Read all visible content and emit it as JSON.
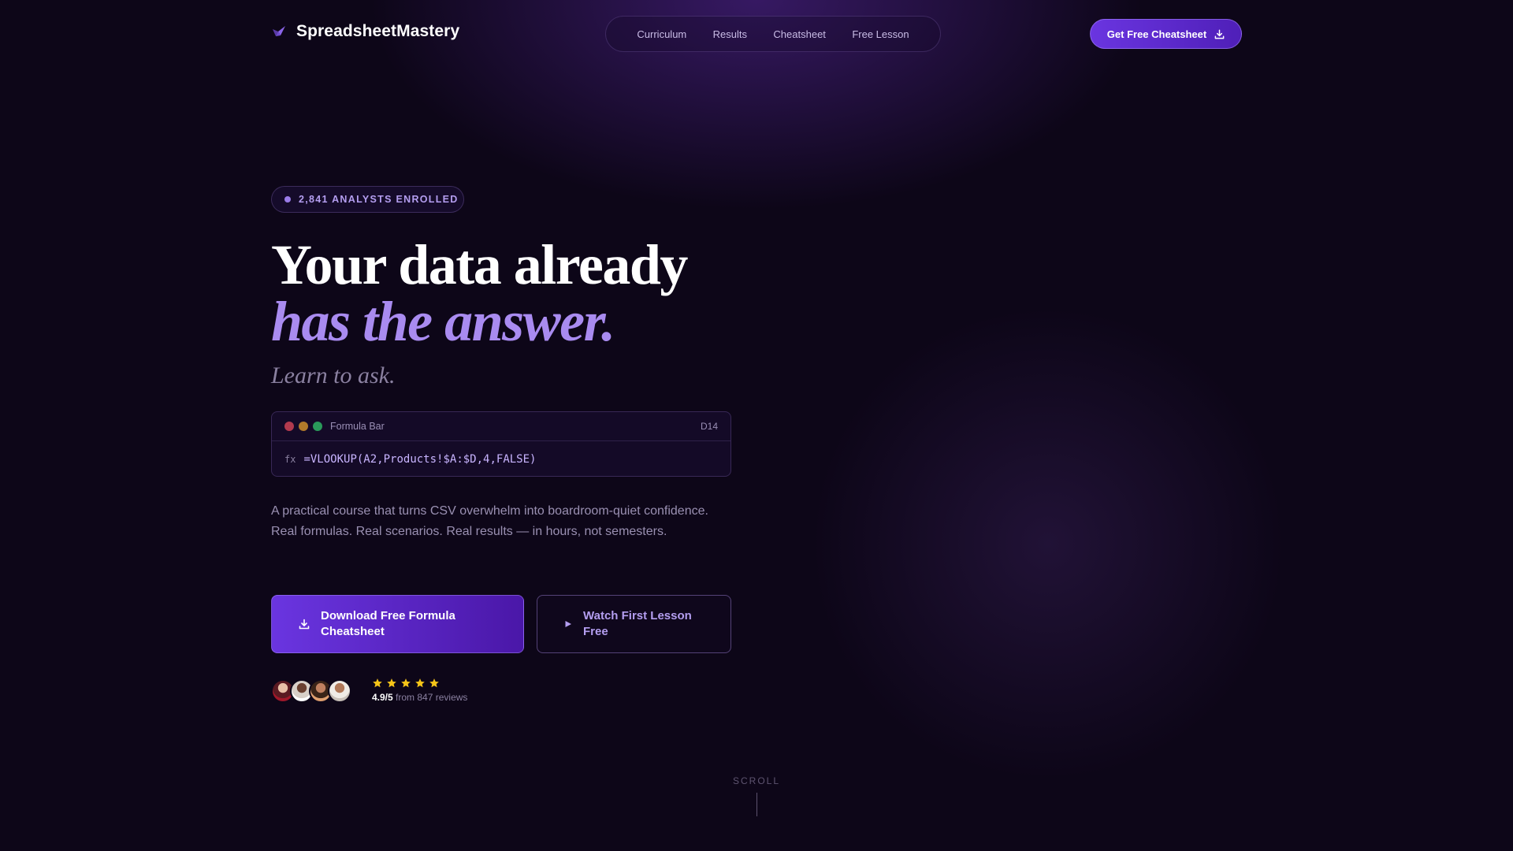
{
  "brand": {
    "name": "SpreadsheetMastery",
    "logo_icon": "bird-logo-icon",
    "accent": "#7c4dff"
  },
  "nav": {
    "links": [
      {
        "label": "Curriculum"
      },
      {
        "label": "Results"
      },
      {
        "label": "Cheatsheet"
      },
      {
        "label": "Free Lesson"
      }
    ],
    "cta_label": "Get Free Cheatsheet",
    "cta_icon": "download-icon"
  },
  "hero": {
    "badge": "2,841 ANALYSTS ENROLLED",
    "headline_line1": "Your data already",
    "headline_line2": "has the answer.",
    "subhead": "Learn to ask.",
    "formula_bar": {
      "title": "Formula Bar",
      "cell": "D14",
      "fx_label": "fx",
      "formula": "=VLOOKUP(A2,Products!$A:$D,4,FALSE)"
    },
    "description": "A practical course that turns CSV overwhelm into boardroom-quiet confidence. Real formulas. Real scenarios. Real results — in hours, not semesters.",
    "primary_cta": "Download Free Formula Cheatsheet",
    "secondary_cta": "Watch First Lesson Free"
  },
  "social_proof": {
    "rating_score": "4.9/5",
    "rating_text": " from 847 reviews",
    "stars": 5,
    "star_color": "#f5c518"
  },
  "scroll_label": "SCROLL"
}
